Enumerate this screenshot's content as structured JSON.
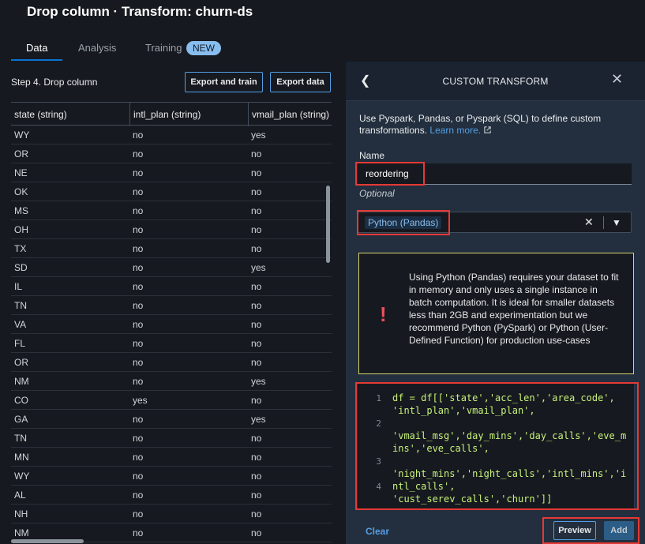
{
  "page": {
    "title": "Drop column · Transform: churn-ds"
  },
  "tabs": [
    {
      "label": "Data",
      "active": true
    },
    {
      "label": "Analysis",
      "active": false
    },
    {
      "label": "Training",
      "active": false,
      "badge": "NEW"
    }
  ],
  "left": {
    "step_title": "Step 4. Drop column",
    "export_train_label": "Export and train",
    "export_data_label": "Export data"
  },
  "table": {
    "columns": [
      "state (string)",
      "intl_plan (string)",
      "vmail_plan (string)"
    ],
    "rows": [
      [
        "WY",
        "no",
        "yes"
      ],
      [
        "OR",
        "no",
        "no"
      ],
      [
        "NE",
        "no",
        "no"
      ],
      [
        "OK",
        "no",
        "no"
      ],
      [
        "MS",
        "no",
        "no"
      ],
      [
        "OH",
        "no",
        "no"
      ],
      [
        "TX",
        "no",
        "no"
      ],
      [
        "SD",
        "no",
        "yes"
      ],
      [
        "IL",
        "no",
        "no"
      ],
      [
        "TN",
        "no",
        "no"
      ],
      [
        "VA",
        "no",
        "no"
      ],
      [
        "FL",
        "no",
        "no"
      ],
      [
        "OR",
        "no",
        "no"
      ],
      [
        "NM",
        "no",
        "yes"
      ],
      [
        "CO",
        "yes",
        "no"
      ],
      [
        "GA",
        "no",
        "yes"
      ],
      [
        "TN",
        "no",
        "no"
      ],
      [
        "MN",
        "no",
        "no"
      ],
      [
        "WY",
        "no",
        "no"
      ],
      [
        "AL",
        "no",
        "no"
      ],
      [
        "NH",
        "no",
        "no"
      ],
      [
        "NM",
        "no",
        "no"
      ]
    ]
  },
  "panel": {
    "title": "CUSTOM TRANSFORM",
    "back_icon": "chevron-left-icon",
    "close_icon": "close-icon",
    "description": "Use Pyspark, Pandas, or Pyspark (SQL) to define custom transformations.",
    "learn_more": "Learn more.",
    "name_label": "Name",
    "name_value": "reordering",
    "optional_label": "Optional",
    "mode_value": "Python (Pandas)",
    "warning_text": "Using Python (Pandas) requires your dataset to fit in memory and only uses a single instance in batch computation. It is ideal for smaller datasets less than 2GB and experimentation but we recommend Python (PySpark) or Python (User-Defined Function) for production use-cases",
    "code_line_numbers": [
      "1",
      "2",
      "3",
      "4"
    ],
    "code_lines": [
      "df = df[['state','acc_len','area_code',",
      "'intl_plan','vmail_plan',",
      "'vmail_msg','day_mins','day_calls','eve_m",
      "ins','eve_calls',",
      "'night_mins','night_calls','intl_mins','i",
      "ntl_calls',",
      "'cust_serev_calls','churn']]"
    ],
    "clear_label": "Clear",
    "preview_label": "Preview",
    "add_label": "Add"
  },
  "colors": {
    "accent": "#539fe5",
    "highlight": "#e53935",
    "warning_border": "#d6d36e",
    "error_icon": "#eb4f5b"
  }
}
